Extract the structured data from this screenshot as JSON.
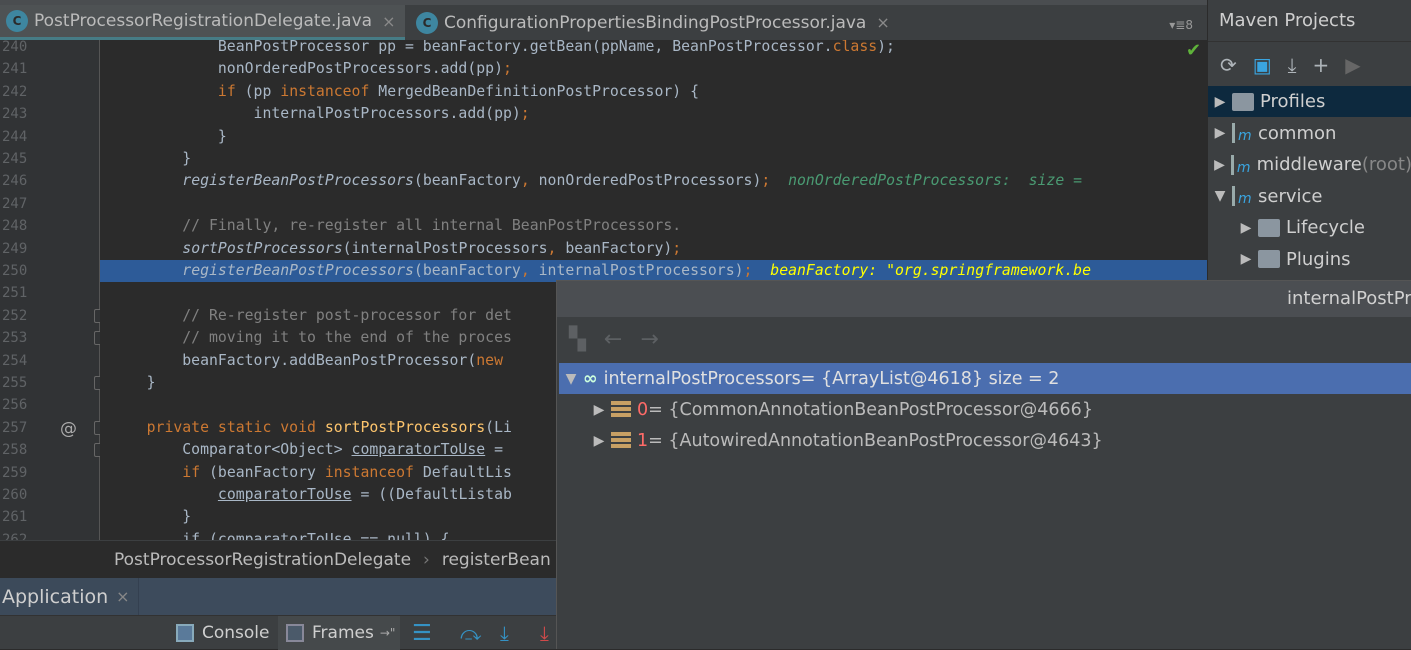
{
  "tabs": [
    {
      "label": "PostProcessorRegistrationDelegate.java",
      "icon": "java-class-icon"
    },
    {
      "label": "ConfigurationPropertiesBindingPostProcessor.java",
      "icon": "java-class-icon"
    }
  ],
  "tab_count": "▾≣8",
  "close_glyph": "×",
  "editor": {
    "highlight_line": 250,
    "lines": [
      {
        "n": "240",
        "t": [
          [
            "            BeanPostProcessor pp = beanFactory.getBean(ppName, BeanPostProcessor.",
            ""
          ],
          [
            "class",
            "k"
          ],
          [
            ");",
            ""
          ]
        ]
      },
      {
        "n": "241",
        "t": [
          [
            "            nonOrderedPostProcessors.add(pp)",
            ""
          ],
          [
            ";",
            "k"
          ]
        ]
      },
      {
        "n": "242",
        "t": [
          [
            "            ",
            ""
          ],
          [
            "if",
            "k"
          ],
          [
            " (pp ",
            ""
          ],
          [
            "instanceof",
            "k"
          ],
          [
            " MergedBeanDefinitionPostProcessor) {",
            ""
          ]
        ]
      },
      {
        "n": "243",
        "t": [
          [
            "                internalPostProcessors.add(pp)",
            ""
          ],
          [
            ";",
            "k"
          ]
        ]
      },
      {
        "n": "244",
        "t": [
          [
            "            }",
            ""
          ]
        ]
      },
      {
        "n": "245",
        "t": [
          [
            "        }",
            ""
          ]
        ]
      },
      {
        "n": "246",
        "t": [
          [
            "        ",
            ""
          ],
          [
            "registerBeanPostProcessors",
            "i"
          ],
          [
            "(beanFactory",
            ""
          ],
          [
            ",",
            "k"
          ],
          [
            " nonOrderedPostProcessors)",
            ""
          ],
          [
            ";",
            "k"
          ],
          [
            "  ",
            ""
          ],
          [
            "nonOrderedPostProcessors:  size = ",
            "hint"
          ]
        ]
      },
      {
        "n": "247",
        "t": []
      },
      {
        "n": "248",
        "t": [
          [
            "        // Finally, re-register all internal BeanPostProcessors.",
            "c"
          ]
        ]
      },
      {
        "n": "249",
        "t": [
          [
            "        ",
            ""
          ],
          [
            "sortPostProcessors",
            "i"
          ],
          [
            "(internalPostProcessors",
            ""
          ],
          [
            ",",
            "k"
          ],
          [
            " beanFactory)",
            ""
          ],
          [
            ";",
            "k"
          ]
        ]
      },
      {
        "n": "250",
        "t": [
          [
            "        ",
            ""
          ],
          [
            "registerBeanPostProcessors",
            "i"
          ],
          [
            "(beanFactory",
            ""
          ],
          [
            ",",
            "k"
          ],
          [
            " internalPostProcessors)",
            ""
          ],
          [
            ";",
            "k"
          ],
          [
            "  ",
            ""
          ],
          [
            "beanFactory: \"org.springframework.be",
            "hinty"
          ]
        ]
      },
      {
        "n": "251",
        "t": []
      },
      {
        "n": "252",
        "t": [
          [
            "        // Re-register post-processor for det",
            "c"
          ]
        ]
      },
      {
        "n": "253",
        "t": [
          [
            "        // moving it to the end of the proces",
            "c"
          ]
        ]
      },
      {
        "n": "254",
        "t": [
          [
            "        beanFactory.addBeanPostProcessor(",
            ""
          ],
          [
            "new",
            "k"
          ]
        ]
      },
      {
        "n": "255",
        "t": [
          [
            "    }",
            ""
          ]
        ]
      },
      {
        "n": "256",
        "t": []
      },
      {
        "n": "257",
        "t": [
          [
            "    ",
            ""
          ],
          [
            "private static void ",
            "k"
          ],
          [
            "sortPostProcessors",
            "fn"
          ],
          [
            "(Li",
            ""
          ]
        ]
      },
      {
        "n": "258",
        "t": [
          [
            "        Comparator<Object> ",
            ""
          ],
          [
            "comparatorToUse",
            "u"
          ],
          [
            " =",
            ""
          ]
        ]
      },
      {
        "n": "259",
        "t": [
          [
            "        ",
            ""
          ],
          [
            "if",
            "k"
          ],
          [
            " (beanFactory ",
            ""
          ],
          [
            "instanceof",
            "k"
          ],
          [
            " DefaultLis",
            ""
          ]
        ]
      },
      {
        "n": "260",
        "t": [
          [
            "            ",
            ""
          ],
          [
            "comparatorToUse",
            "u"
          ],
          [
            " = ((DefaultListab",
            ""
          ]
        ]
      },
      {
        "n": "261",
        "t": [
          [
            "        }",
            ""
          ]
        ]
      },
      {
        "n": "262",
        "t": [
          [
            "        if (comparatorToUse == null) {",
            ""
          ]
        ]
      }
    ]
  },
  "breadcrumb": [
    "PostProcessorRegistrationDelegate",
    "registerBean"
  ],
  "breadcrumb_sep": "›",
  "run_tab": {
    "label": "Application"
  },
  "debug_toolbar": {
    "console": "Console",
    "frames": "Frames",
    "frames_pin": "→\""
  },
  "maven": {
    "title": "Maven Projects",
    "toolbar": [
      "reimport-icon",
      "generate-sources-icon",
      "download-icon",
      "add-icon",
      "run-icon"
    ],
    "items": [
      {
        "label": "Profiles",
        "suffix": "",
        "expanded": false,
        "level": 0,
        "icon": "profiles-folder-icon",
        "selected": true
      },
      {
        "label": "common",
        "suffix": "",
        "expanded": false,
        "level": 0,
        "icon": "maven-module-icon"
      },
      {
        "label": "middleware",
        "suffix": " (root)",
        "expanded": false,
        "level": 0,
        "icon": "maven-module-icon"
      },
      {
        "label": "service",
        "suffix": "",
        "expanded": true,
        "level": 0,
        "icon": "maven-module-icon"
      },
      {
        "label": "Lifecycle",
        "suffix": "",
        "expanded": false,
        "level": 1,
        "icon": "lifecycle-folder-icon"
      },
      {
        "label": "Plugins",
        "suffix": "",
        "expanded": false,
        "level": 1,
        "icon": "plugins-folder-icon"
      }
    ]
  },
  "popup": {
    "title": "internalPostProcessors",
    "root": {
      "name": "internalPostProcessors",
      "value": " = {ArrayList@4618}  size = 2"
    },
    "children": [
      {
        "index": "0",
        "value": " = {CommonAnnotationBeanPostProcessor@4666}"
      },
      {
        "index": "1",
        "value": " = {AutowiredAnnotationBeanPostProcessor@4643}"
      }
    ]
  },
  "colors": {
    "selection": "#2d5b98",
    "tree_selection": "#4b6eaf",
    "keyword": "#cc7832",
    "hint": "#4a9a72",
    "index": "#ff6b68"
  }
}
